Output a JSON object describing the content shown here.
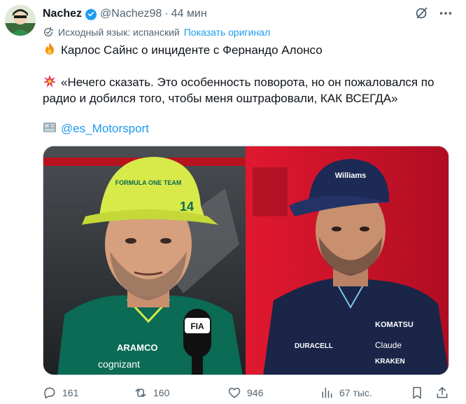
{
  "tweet": {
    "author_name": "Nachez",
    "handle": "@Nachez98",
    "separator": "·",
    "time": "44 мин",
    "translation_note": "Исходный язык: испанский",
    "show_original": "Показать оригинал",
    "line1_emoji": "fire-emoji",
    "line1": "Карлос Сайнс о инциденте с Фернандо Алонсо",
    "line2_emoji": "collision-emoji",
    "line2": "«Нечего сказать. Это особенность поворота, но он пожаловался по",
    "line3": "радио и добился того, чтобы меня оштрафовали, КАК ВСЕГДА»",
    "source_emoji": "newspaper-emoji",
    "source_mention": "@es_Motorsport"
  },
  "media": {
    "left_photo": {
      "description_icon": "photo",
      "cap_text": "FORMULA ONE TEAM",
      "cap_number": "14",
      "sponsor_1": "ARAMCO",
      "sponsor_2": "cognizant",
      "mic_label": "FIA"
    },
    "right_photo": {
      "description_icon": "photo",
      "cap_text": "Williams",
      "sponsor_1": "KOMATSU",
      "sponsor_2": "DURACELL",
      "sponsor_3": "Claude",
      "sponsor_4": "KRAKEN"
    }
  },
  "actions": {
    "replies": "161",
    "reposts": "160",
    "likes": "946",
    "views": "67 тыс."
  },
  "colors": {
    "text": "#0f1419",
    "muted": "#536471",
    "link": "#1d9bf0",
    "verified": "#1d9bf0"
  }
}
